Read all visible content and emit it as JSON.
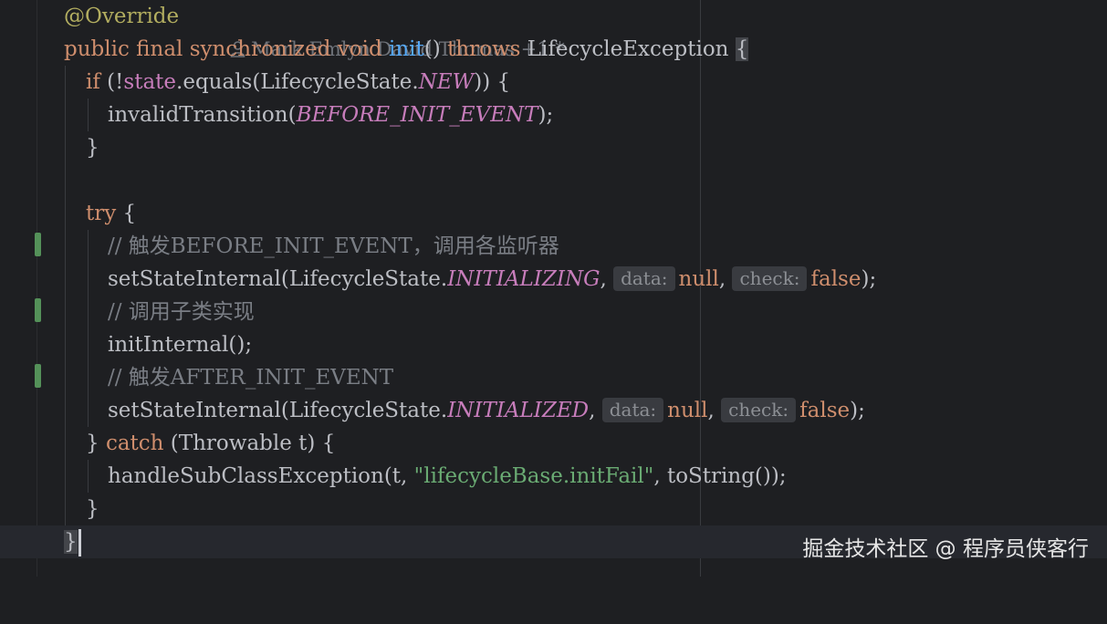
{
  "editor": {
    "annotation": "@Override",
    "author_hint": "Mark Emlyn David Thomas +1 *",
    "lines": {
      "l2": {
        "kw": "public final synchronized void ",
        "fn": "init",
        "rest": "() ",
        "kw2": "throws",
        "type": " LifecycleException ",
        "brace": "{"
      },
      "l3": {
        "kw": "if",
        "a": " (!",
        "field": "state",
        "b": ".equals(LifecycleState.",
        "const": "NEW",
        "c": ")) {"
      },
      "l4": {
        "a": "invalidTransition(",
        "const": "BEFORE_INIT_EVENT",
        "b": ");"
      },
      "l5": "}",
      "l7": {
        "kw": "try",
        "a": " {"
      },
      "l8": "// 触发BEFORE_INIT_EVENT，调用各监听器",
      "l9": {
        "a": "setStateInternal(LifecycleState.",
        "const": "INITIALIZING",
        "b": ", ",
        "hint1": "data:",
        "null": "null",
        "c": ", ",
        "hint2": "check:",
        "false": "false",
        "d": ");"
      },
      "l10": "// 调用子类实现",
      "l11": "initInternal();",
      "l12": "// 触发AFTER_INIT_EVENT",
      "l13": {
        "a": "setStateInternal(LifecycleState.",
        "const": "INITIALIZED",
        "b": ", ",
        "hint1": "data:",
        "null": "null",
        "c": ", ",
        "hint2": "check:",
        "false": "false",
        "d": ");"
      },
      "l14": {
        "a": "} ",
        "kw": "catch",
        "b": " (Throwable t) {"
      },
      "l15": {
        "a": "handleSubClassException(t, ",
        "str": "\"lifecycleBase.initFail\"",
        "b": ", toString());"
      },
      "l16": "}",
      "l17": "}"
    }
  },
  "watermark": "掘金技术社区 @ 程序员侠客行",
  "colors": {
    "background": "#1e1f22",
    "keyword": "#cf8e6d",
    "function": "#56a8f5",
    "constant": "#c77dbb",
    "string": "#6aab73",
    "comment": "#7a7e85",
    "annotation": "#b3ae60",
    "change_marker": "#549159"
  },
  "icons": [
    "person-icon"
  ]
}
